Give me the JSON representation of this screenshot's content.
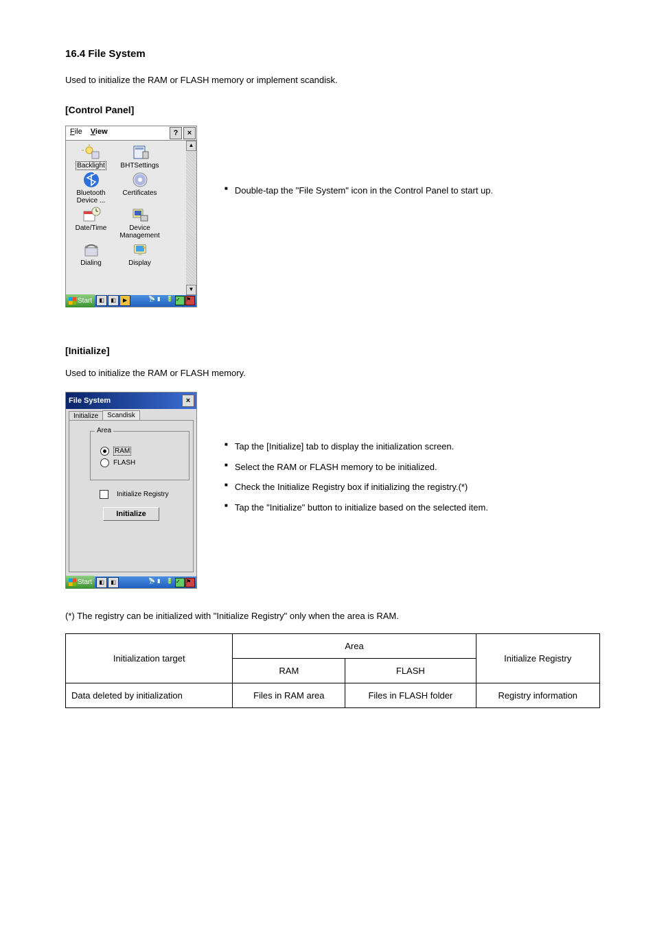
{
  "section_title": "16.4 File System",
  "intro_line": "Used to initialize the RAM or FLASH memory or implement scandisk.",
  "subsec_cp": "[Control Panel]",
  "cp_desc": "Double-tap the \"File System\" icon in the Control Panel to start up.",
  "cp_menu": {
    "file": "File",
    "view": "View",
    "help": "?",
    "close": "×"
  },
  "icons": [
    [
      {
        "label": "Backlight"
      },
      {
        "label": "BHTSettings"
      }
    ],
    [
      {
        "label": "Bluetooth\nDevice ..."
      },
      {
        "label": "Certificates"
      }
    ],
    [
      {
        "label": "Date/Time"
      },
      {
        "label": "Device\nManagement"
      }
    ],
    [
      {
        "label": "Dialing"
      },
      {
        "label": "Display"
      }
    ]
  ],
  "start": "Start",
  "subsec_init": "[Initialize]",
  "init_desc": "Used to initialize the RAM or FLASH memory.",
  "init_steps": [
    "Tap the [Initialize] tab to display the initialization screen.",
    "Select the RAM or FLASH memory to be initialized.",
    "Check the Initialize Registry box if initializing the registry.(*)",
    "Tap the \"Initialize\" button to initialize based on the selected item."
  ],
  "fs_window": {
    "title": "File System",
    "close": "×",
    "tab1": "Initialize",
    "tab2": "Scandisk",
    "legend": "Area",
    "opt_ram": "RAM",
    "opt_flash": "FLASH",
    "chk_label": "Initialize Registry",
    "btn": "Initialize"
  },
  "note": "(*) The registry can be initialized with \"Initialize Registry\" only when the area is RAM.",
  "table": {
    "h_target": "Initialization target",
    "h_area": "Area",
    "h_ram": "RAM",
    "h_flash": "FLASH",
    "h_reg": "Initialize Registry",
    "r_deleted": "Data deleted by initialization",
    "r_files_ram": "Files in RAM area",
    "r_files_flash": "Files in FLASH folder",
    "r_registry": "Registry information"
  }
}
